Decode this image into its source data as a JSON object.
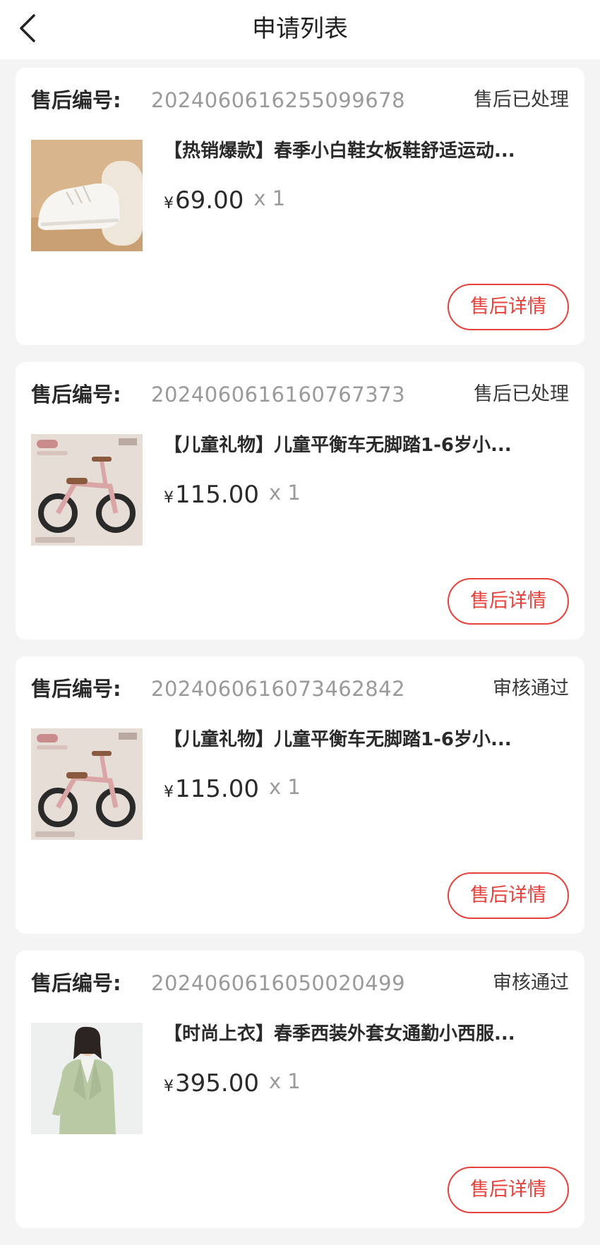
{
  "header": {
    "title": "申请列表"
  },
  "labels": {
    "sn_label": "售后编号:",
    "currency": "¥",
    "detail_button": "售后详情"
  },
  "orders": [
    {
      "sn": "2024060616255099678",
      "status": "售后已处理",
      "title": "【热销爆款】春季小白鞋女板鞋舒适运动...",
      "price": "69.00",
      "qty": "x 1",
      "thumb": "white-sneaker-image"
    },
    {
      "sn": "2024060616160767373",
      "status": "售后已处理",
      "title": "【儿童礼物】儿童平衡车无脚踏1-6岁小...",
      "price": "115.00",
      "qty": "x 1",
      "thumb": "pink-balance-bike-image"
    },
    {
      "sn": "2024060616073462842",
      "status": "审核通过",
      "title": "【儿童礼物】儿童平衡车无脚踏1-6岁小...",
      "price": "115.00",
      "qty": "x 1",
      "thumb": "pink-balance-bike-image"
    },
    {
      "sn": "2024060616050020499",
      "status": "审核通过",
      "title": "【时尚上衣】春季西装外套女通勤小西服...",
      "price": "395.00",
      "qty": "x 1",
      "thumb": "green-blazer-image"
    }
  ],
  "colors": {
    "accent": "#e8413b",
    "background": "#f4f4f4"
  }
}
